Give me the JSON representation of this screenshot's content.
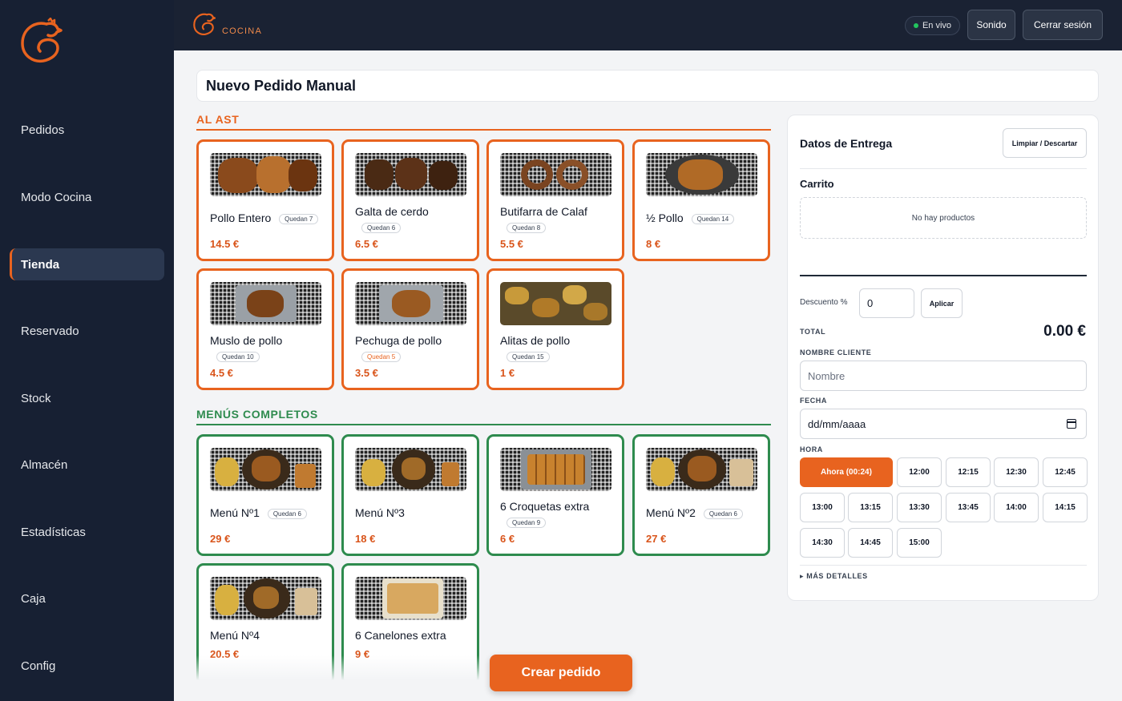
{
  "sidebar": {
    "items": [
      {
        "label": "Pedidos"
      },
      {
        "label": "Modo Cocina"
      },
      {
        "label": "Tienda"
      },
      {
        "label": "Reservado"
      },
      {
        "label": "Stock"
      },
      {
        "label": "Almacén"
      },
      {
        "label": "Estadísticas"
      },
      {
        "label": "Caja"
      },
      {
        "label": "Config"
      }
    ],
    "active": "Tienda"
  },
  "header": {
    "brand": "COCINA",
    "status": "En vivo",
    "sound_label": "Sonido",
    "logout_label": "Cerrar sesión"
  },
  "page": {
    "title": "Nuevo Pedido Manual"
  },
  "sections": {
    "al_ast": {
      "title": "AL AST",
      "products": [
        {
          "name": "Pollo Entero",
          "stock": "Quedan 7",
          "price": "14.5 €"
        },
        {
          "name": "Galta de cerdo",
          "stock": "Quedan 6",
          "price": "6.5 €"
        },
        {
          "name": "Butifarra de Calaf",
          "stock": "Quedan 8",
          "price": "5.5 €"
        },
        {
          "name": "½ Pollo",
          "stock": "Quedan 14",
          "price": "8 €"
        },
        {
          "name": "Muslo de pollo",
          "stock": "Quedan 10",
          "price": "4.5 €"
        },
        {
          "name": "Pechuga de pollo",
          "stock": "Quedan 5",
          "price": "3.5 €"
        },
        {
          "name": "Alitas de pollo",
          "stock": "Quedan 15",
          "price": "1 €"
        }
      ]
    },
    "menus": {
      "title": "MENÚS COMPLETOS",
      "products": [
        {
          "name": "Menú Nº1",
          "stock": "Quedan 6",
          "price": "29 €"
        },
        {
          "name": "Menú Nº3",
          "stock": "",
          "price": "18 €"
        },
        {
          "name": "6 Croquetas extra",
          "stock": "Quedan 9",
          "price": "6 €"
        },
        {
          "name": "Menú Nº2",
          "stock": "Quedan 6",
          "price": "27 €"
        },
        {
          "name": "Menú Nº4",
          "stock": "",
          "price": "20.5 €"
        },
        {
          "name": "6 Canelones extra",
          "stock": "",
          "price": "9 €"
        }
      ]
    }
  },
  "create_button": "Crear pedido",
  "delivery": {
    "title": "Datos de Entrega",
    "clear_label": "Limpiar / Descartar",
    "cart_label": "Carrito",
    "cart_empty": "No hay productos",
    "discount_label": "Descuento %",
    "discount_value": "0",
    "apply_label": "Aplicar",
    "total_label": "TOTAL",
    "total_value": "0.00 €",
    "client_label": "NOMBRE CLIENTE",
    "client_placeholder": "Nombre",
    "date_label": "FECHA",
    "date_placeholder": "dd/mm/aaaa",
    "hour_label": "HORA",
    "times": [
      "Ahora (00:24)",
      "12:00",
      "12:15",
      "12:30",
      "12:45",
      "13:00",
      "13:15",
      "13:30",
      "13:45",
      "14:00",
      "14:15",
      "14:30",
      "14:45",
      "15:00"
    ],
    "selected_time": "Ahora (00:24)",
    "more_label": "▸ MÁS DETALLES"
  },
  "colors": {
    "accent": "#e8631f",
    "green": "#2e8b4e",
    "sidebar": "#172033"
  }
}
